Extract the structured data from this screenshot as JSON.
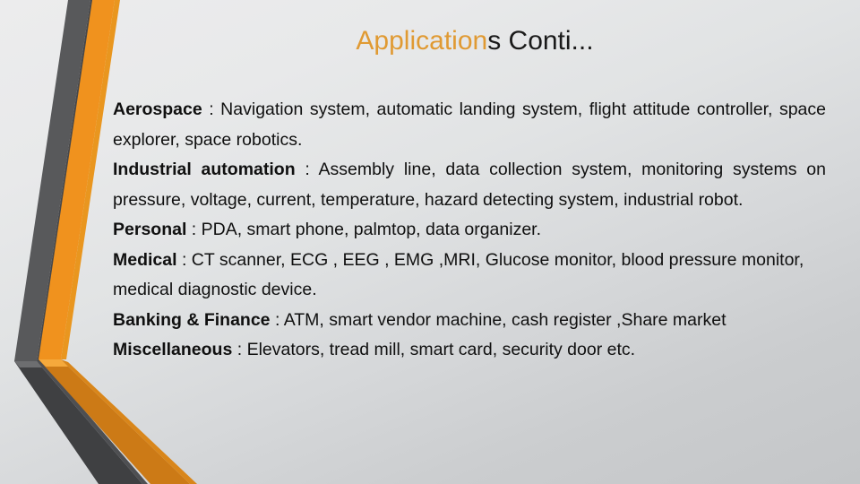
{
  "slide": {
    "title": {
      "accent_text": "Application",
      "rest_text": "s Conti...",
      "accent_color": "#E09A33",
      "rest_color": "#1a1a1a"
    },
    "background": {
      "start_color": "#ececed",
      "end_color": "#c4c6c8"
    },
    "decoration": {
      "name": "chevron-ribbon",
      "gray_color": "#58595b",
      "gray_shade_color": "#3f4042",
      "orange_color": "#F0921E",
      "orange_shade_color": "#CC7A16",
      "orange_edge_color": "#E9961F"
    },
    "body": {
      "entries": [
        {
          "lead": "Aerospace",
          "text": " : Navigation system, automatic landing system, flight attitude controller,  space explorer, space robotics.",
          "justified": true
        },
        {
          "lead": "Industrial automation",
          "text": " : Assembly line, data collection system, monitoring systems on pressure,   voltage, current, temperature, hazard detecting system, industrial robot.",
          "justified": true
        },
        {
          "lead": "Personal",
          "text": " : PDA, smart phone, palmtop, data organizer.",
          "justified": false
        },
        {
          "lead": "Medical",
          "text": " : CT scanner,  ECG , EEG , EMG ,MRI, Glucose monitor, blood pressure monitor, medical diagnostic device.",
          "justified": false
        },
        {
          "lead": "Banking & Finance",
          "text": " : ATM, smart vendor machine, cash register ,Share market",
          "justified": false
        },
        {
          "lead": "Miscellaneous",
          "text": " : Elevators, tread mill, smart card, security door etc.",
          "justified": false
        }
      ]
    }
  }
}
